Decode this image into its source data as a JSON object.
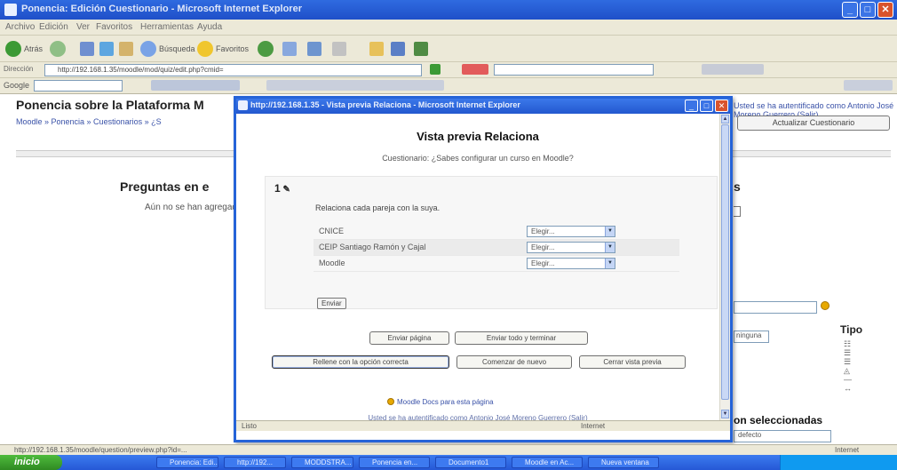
{
  "browser": {
    "title": "Ponencia: Edición Cuestionario - Microsoft Internet Explorer",
    "menu": [
      "Archivo",
      "Edición",
      "Ver",
      "Favoritos",
      "Herramientas",
      "Ayuda"
    ],
    "address_label": "Dirección",
    "address_value": "http://192.168.1.35/moodle/mod/quiz/edit.php?cmid=",
    "back_label": "Atrás",
    "search_label": "Búsqueda",
    "favorites_label": "Favoritos",
    "google_label": "Google",
    "status_left": "http://192.168.1.35/moodle/question/preview.php?id=...",
    "status_right": "Internet"
  },
  "moodle": {
    "page_title": "Ponencia sobre la Plataforma M",
    "breadcrumb": "Moodle » Ponencia » Cuestionarios » ¿S",
    "login_info": "Usted se ha autentificado como Antonio José Moreno Guerrero (Salir)",
    "update_button": "Actualizar Cuestionario",
    "questions_heading": "Preguntas en e",
    "no_questions": "Aún no se han agregado",
    "right_heading": "s",
    "right_select": "ninguna",
    "type_label": "Tipo",
    "selected_heading": "on seleccionadas",
    "default_select": "defecto"
  },
  "popup": {
    "title": "http://192.168.1.35 - Vista previa Relaciona - Microsoft Internet Explorer",
    "heading": "Vista previa Relaciona",
    "quiz_line": "Cuestionario: ¿Sabes configurar un curso en Moodle?",
    "question_number": "1",
    "question_text": "Relaciona cada pareja con la suya.",
    "rows": [
      {
        "label": "CNICE",
        "select": "Elegir..."
      },
      {
        "label": "CEIP Santiago Ramón y Cajal",
        "select": "Elegir..."
      },
      {
        "label": "Moodle",
        "select": "Elegir..."
      }
    ],
    "submit_small": "Enviar",
    "btn_submit_page": "Enviar página",
    "btn_submit_all": "Enviar todo y terminar",
    "btn_fill_correct": "Rellene con la opción correcta",
    "btn_start_again": "Comenzar de nuevo",
    "btn_close_preview": "Cerrar vista previa",
    "doc_link": "Moodle Docs para esta página",
    "auth_line": "Usted se ha autentificado como Antonio José Moreno Guerrero (Salir)",
    "status_left": "Listo",
    "status_right": "Internet"
  },
  "taskbar": {
    "start": "inicio",
    "items": [
      "Ponencia: Edi...",
      "http://192...",
      "MODDSTRA...",
      "Ponencia en...",
      "Documento1",
      "Moodle en Ac...",
      "Nueva ventana"
    ]
  },
  "colors": {
    "xp_blue": "#2563d8",
    "moodle_link": "#3a52a8",
    "start_green": "#3a9b2b"
  }
}
